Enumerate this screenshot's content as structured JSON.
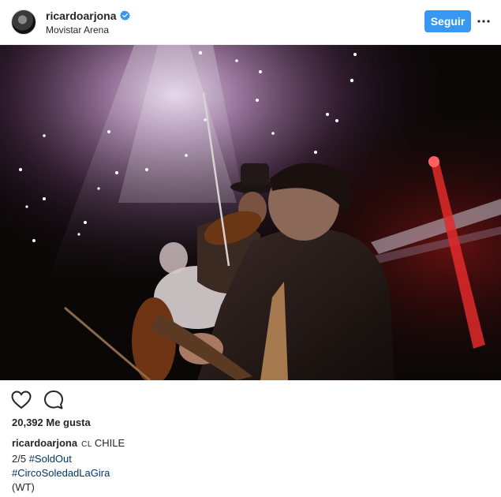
{
  "header": {
    "username": "ricardoarjona",
    "location": "Movistar Arena",
    "follow_label": "Seguir"
  },
  "photo": {
    "alt_hint": ""
  },
  "actions": {
    "like_icon": "heart-icon",
    "comment_icon": "comment-icon"
  },
  "stats": {
    "likes_text": "20,392 Me gusta"
  },
  "caption": {
    "username": "ricardoarjona",
    "flag": "CL",
    "line1_text": "CHILE",
    "line2_prefix": "2/5 ",
    "line2_tag": "#SoldOut",
    "line3_tag": "#CircoSoledadLaGira",
    "line4_text": "(WT)"
  },
  "colors": {
    "follow_button": "#3897f0",
    "hashtag": "#003569",
    "verified_badge": "#3897f0",
    "text": "#262626"
  }
}
